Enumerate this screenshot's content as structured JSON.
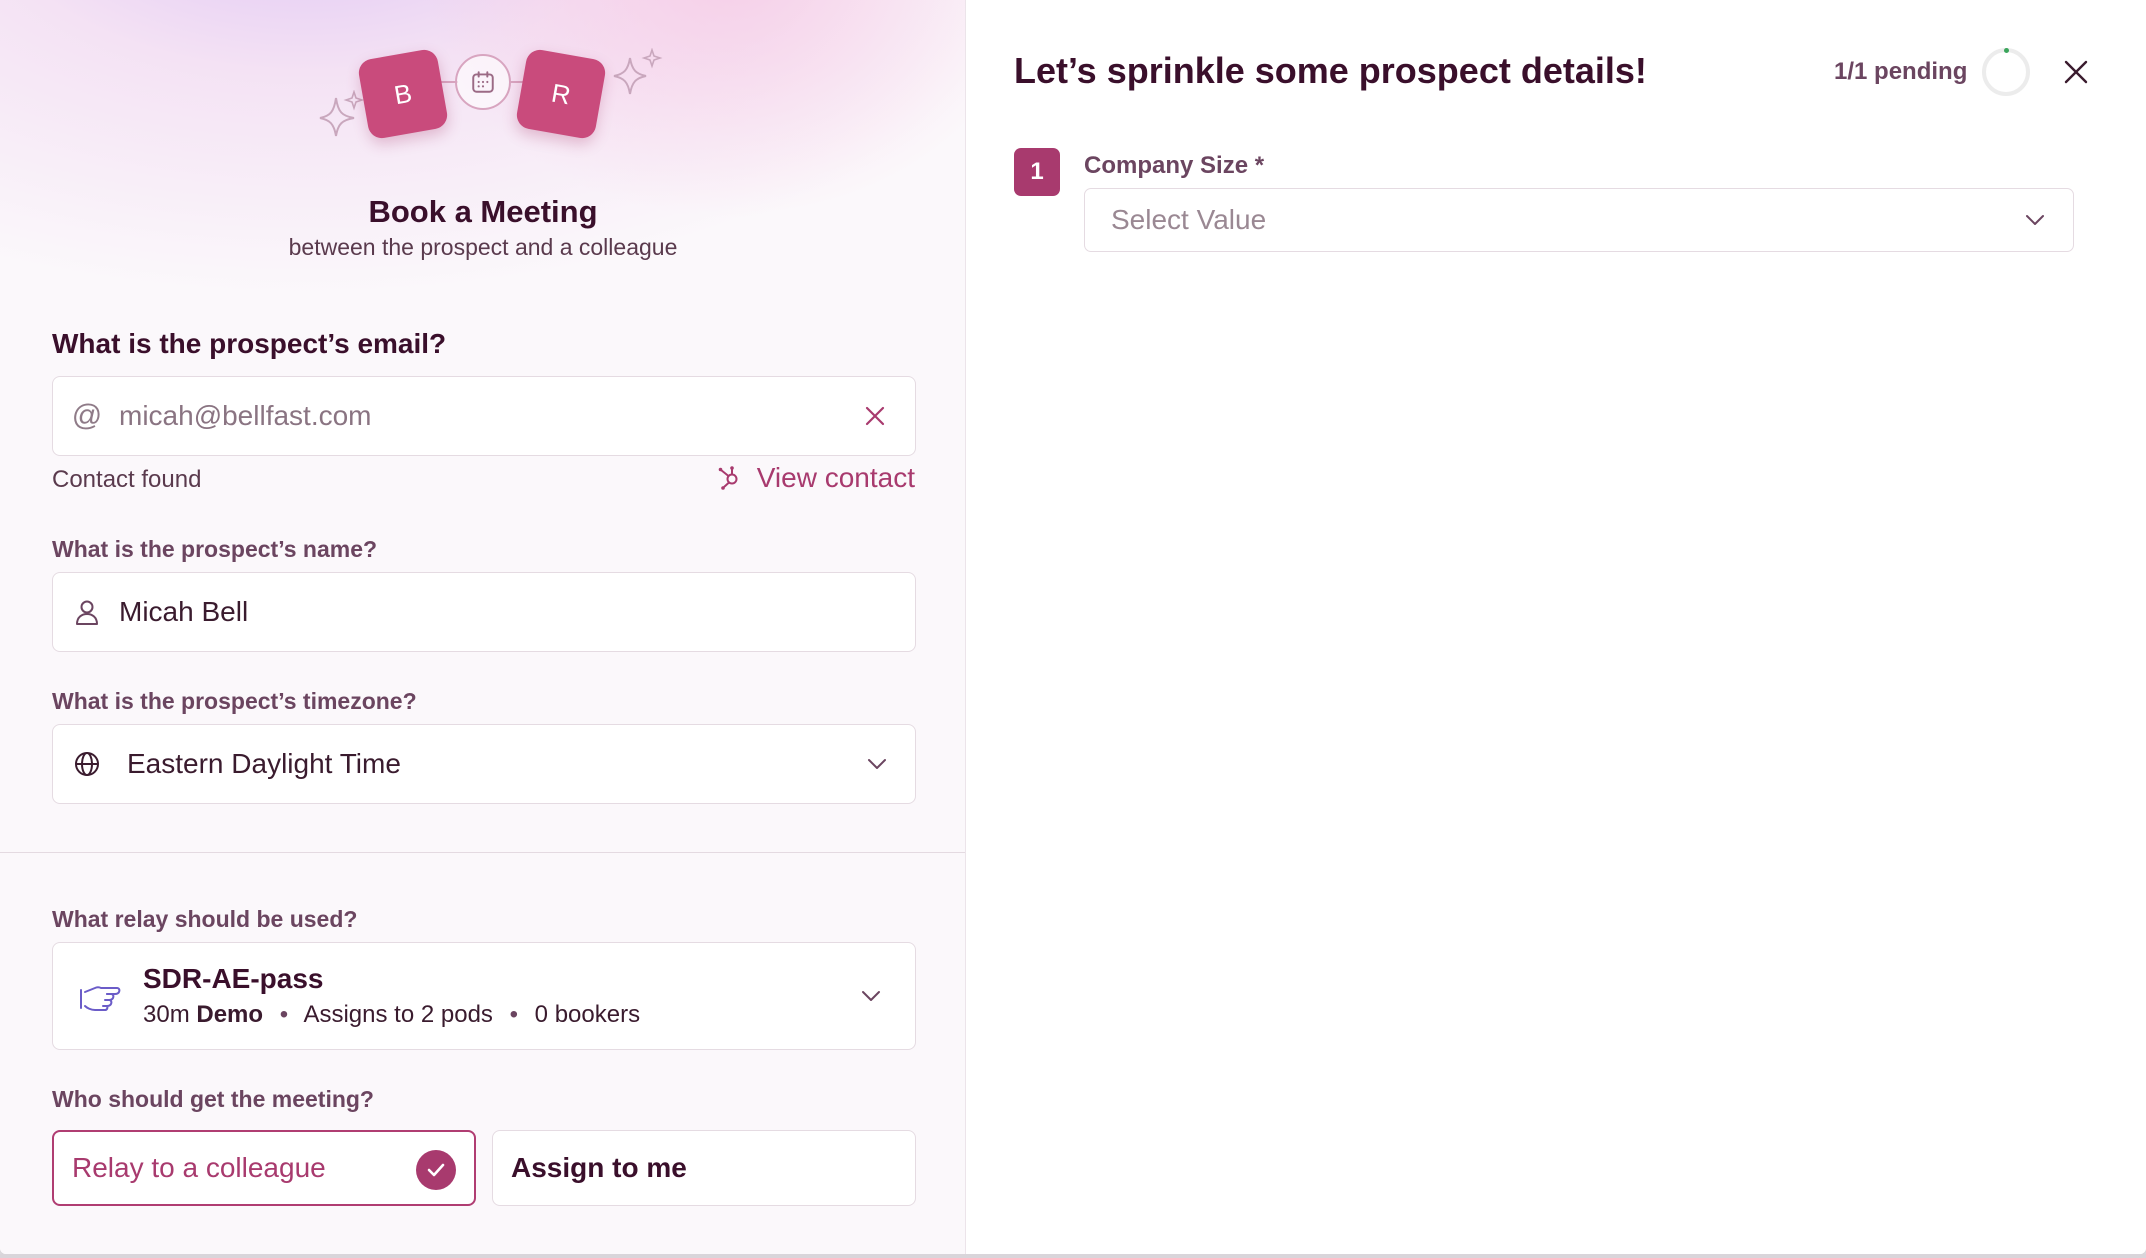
{
  "hero": {
    "tile_left": "B",
    "tile_right": "R",
    "title": "Book a Meeting",
    "subtitle": "between the prospect and a colleague"
  },
  "email": {
    "label": "What is the prospect’s email?",
    "value": "micah@bellfast.com",
    "at_symbol": "@",
    "status": "Contact found",
    "view_contact_label": "View contact"
  },
  "name": {
    "label": "What is the prospect’s name?",
    "value": "Micah Bell"
  },
  "timezone": {
    "label": "What is the prospect’s timezone?",
    "value": "Eastern Daylight Time"
  },
  "relay": {
    "label": "What relay should be used?",
    "name": "SDR-AE-pass",
    "duration": "30m",
    "meeting_type": "Demo",
    "pods": "Assigns to 2 pods",
    "bookers": "0 bookers",
    "separator": "•"
  },
  "assignment": {
    "label": "Who should get the meeting?",
    "option_relay": "Relay to a colleague",
    "option_me": "Assign to me",
    "selected": "relay"
  },
  "details": {
    "title": "Let’s sprinkle some prospect details!",
    "pending": "1/1 pending",
    "fields": [
      {
        "step": "1",
        "label": "Company Size *",
        "placeholder": "Select Value"
      }
    ]
  },
  "colors": {
    "accent": "#a83a6e",
    "tile": "#c94b7c",
    "heading": "#3a0f2b",
    "label": "#6b4560",
    "border": "#e5dbe2",
    "spinner_dot": "#3aa55b"
  }
}
